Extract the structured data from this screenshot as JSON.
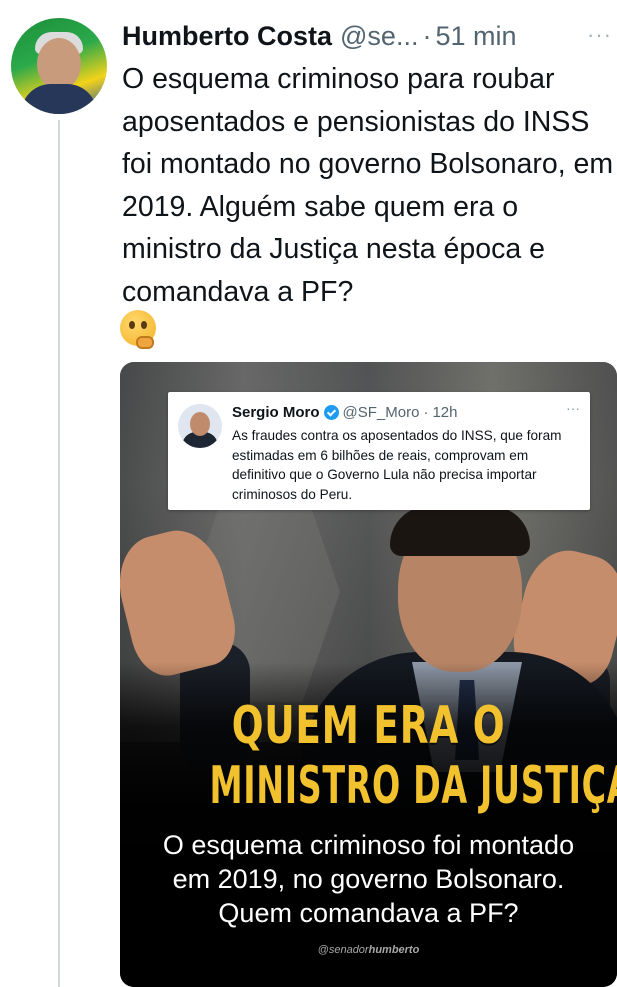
{
  "tweet": {
    "author_name": "Humberto Costa",
    "author_handle": "@se...",
    "separator": "·",
    "time": "51 min",
    "more": "···",
    "text": "O esquema criminoso para roubar aposentados e pensionistas do INSS foi montado no governo Bolsonaro, em 2019. Alguém sabe quem era o ministro da Justiça nesta época e comandava a PF?",
    "emoji": "thinking-face"
  },
  "media": {
    "quoted_tweet": {
      "author_name": "Sergio Moro",
      "author_handle": "@SF_Moro",
      "separator": "·",
      "time": "12h",
      "more": "···",
      "text": "As fraudes contra os aposentados do INSS, que foram estimadas em 6 bilhões de reais, comprovam em definitivo que o Governo Lula não precisa importar criminosos do Peru."
    },
    "headline_line1": "QUEM ERA O",
    "headline_line2": "MINISTRO DA JUSTIÇA?",
    "subtext_line1": "O esquema criminoso foi montado",
    "subtext_line2": "em 2019, no governo Bolsonaro.",
    "subtext_line3": "Quem comandava a PF?",
    "credit_prefix": "@senador",
    "credit_suffix": "humberto"
  },
  "colors": {
    "headline": "#f2c12e",
    "verified": "#1d9bf0",
    "muted_text": "#536471"
  }
}
